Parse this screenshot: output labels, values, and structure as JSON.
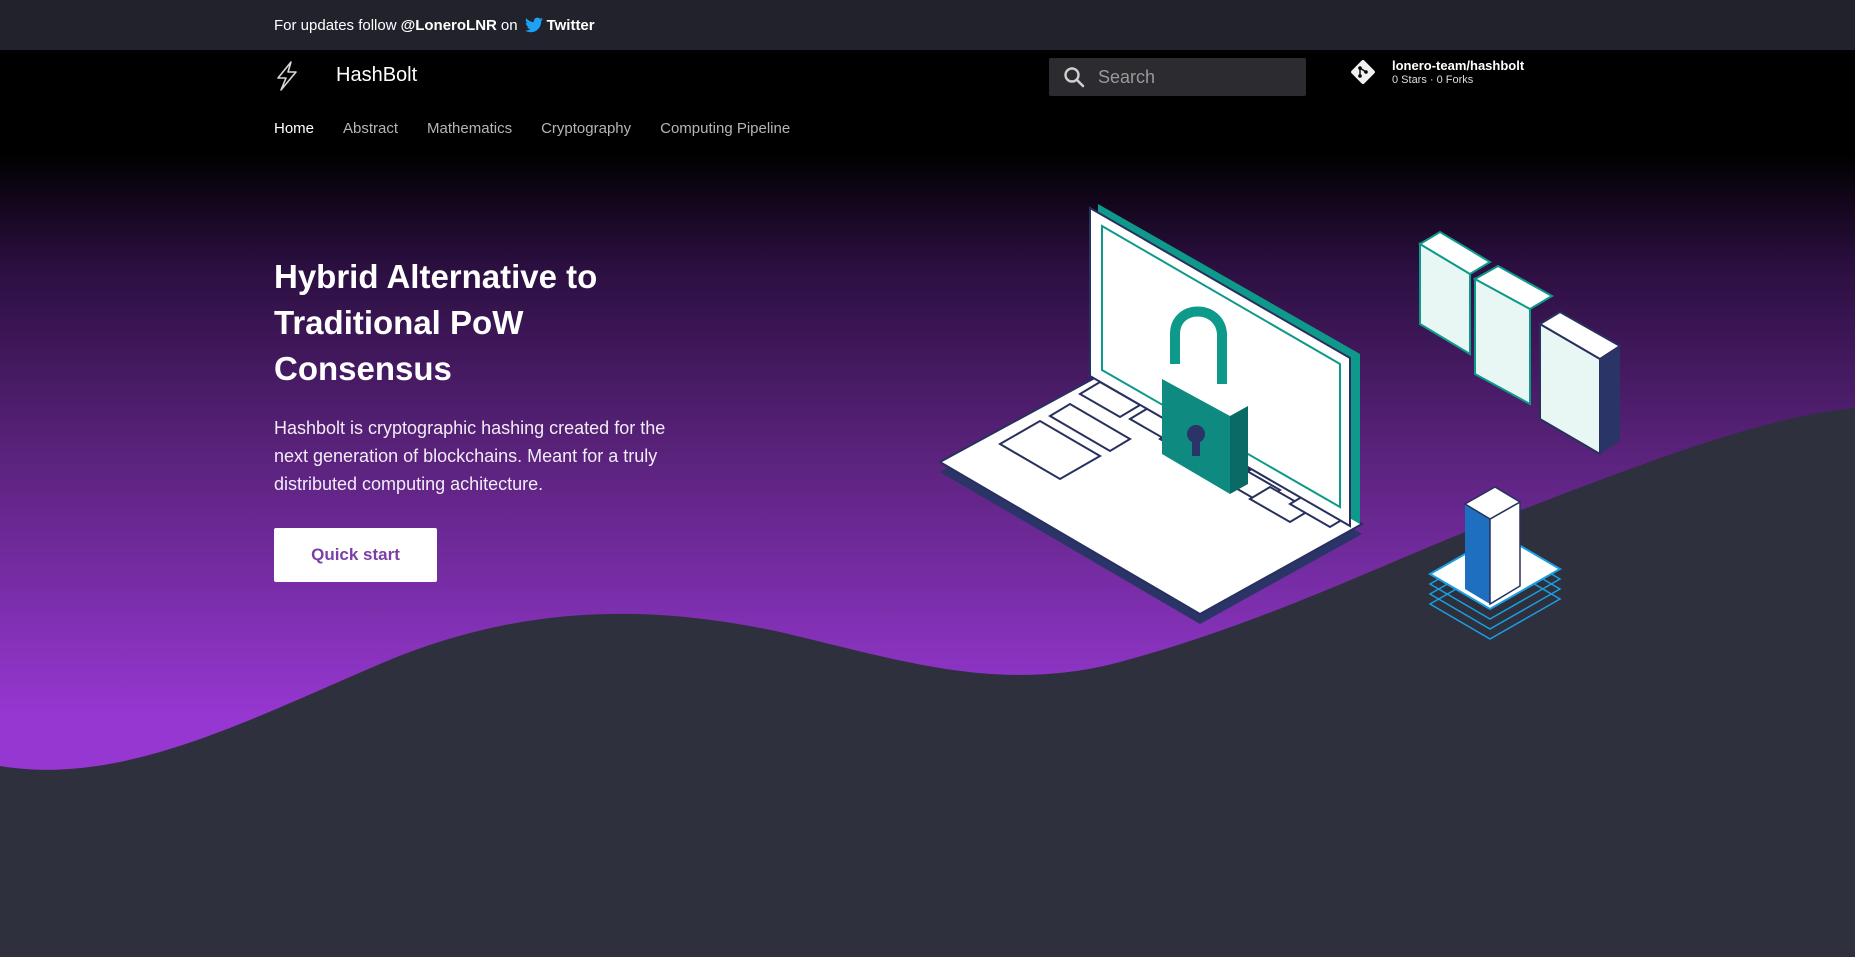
{
  "announcement": {
    "prefix": "For updates follow",
    "handle": "@LoneroLNR",
    "middle": "on",
    "network": "Twitter"
  },
  "header": {
    "site_title": "HashBolt",
    "search_placeholder": "Search",
    "repo": {
      "name": "lonero-team/hashbolt",
      "facts": "0 Stars · 0 Forks"
    }
  },
  "tabs": [
    {
      "label": "Home",
      "active": true
    },
    {
      "label": "Abstract"
    },
    {
      "label": "Mathematics"
    },
    {
      "label": "Cryptography"
    },
    {
      "label": "Computing Pipeline"
    }
  ],
  "hero": {
    "title": "Hybrid Alternative to\nTraditional PoW\nConsensus",
    "text": "Hashbolt is cryptographic hashing created for the next generation of blockchains. Meant for a truly distributed computing achitecture.",
    "cta_label": "Quick start"
  },
  "icons": {
    "logo": "bolt-icon",
    "announcement": "twitter-bird-icon",
    "search": "search-icon",
    "repo": "git-icon"
  },
  "colors": {
    "announcement_bg": "#21222c",
    "header_bg": "#000000",
    "hero_purple": "#9637d1",
    "body_bg": "#2e303e",
    "cta_text": "#7b3fa8",
    "twitter_blue": "#1da1f2",
    "teal": "#0e9a8a"
  }
}
